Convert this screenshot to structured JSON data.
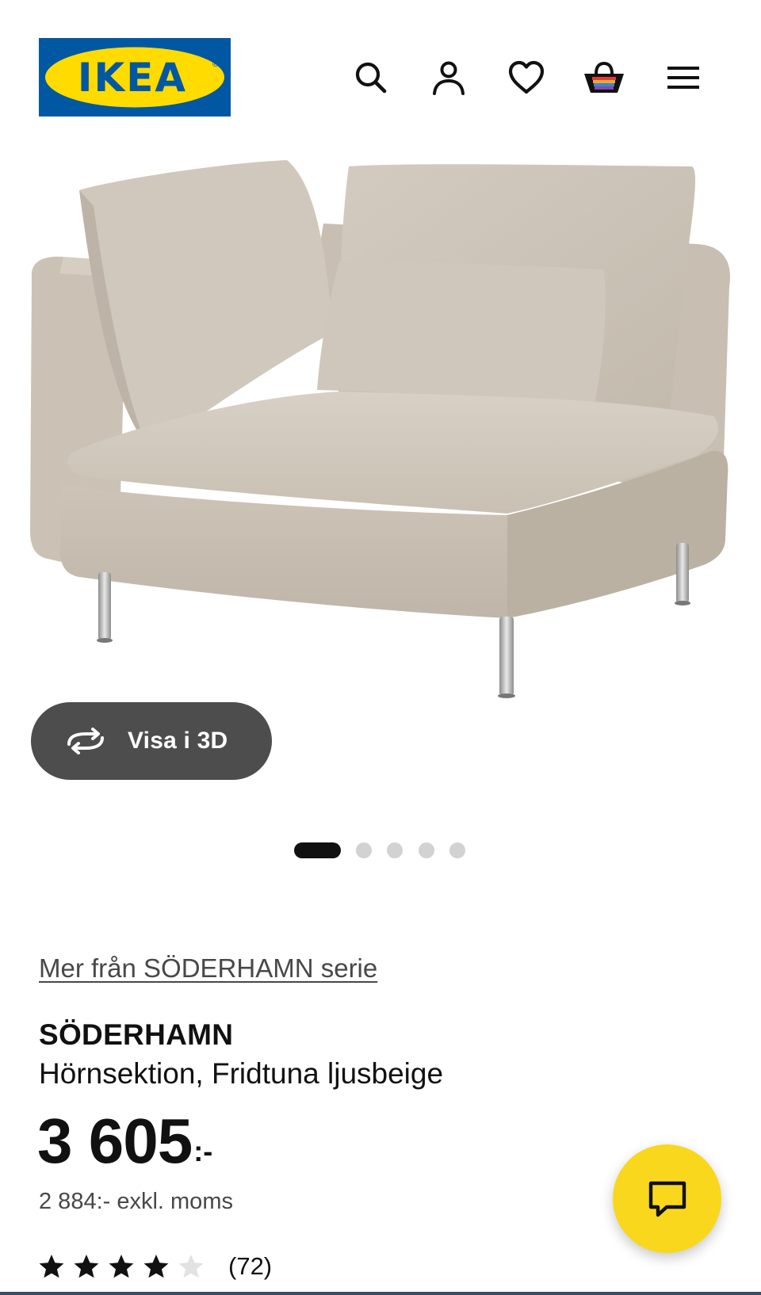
{
  "header": {
    "logo_text": "IKEA",
    "logo_mark": "®",
    "icons": [
      "search-icon",
      "account-icon",
      "heart-icon",
      "basket-icon",
      "menu-icon"
    ]
  },
  "gallery": {
    "view_3d_label": "Visa i 3D",
    "view_3d_icon": "rotate-3d-icon",
    "slide_count": 5,
    "active_slide": 1
  },
  "product": {
    "series_link": "Mer från SÖDERHAMN serie",
    "name": "SÖDERHAMN",
    "description": "Hörnsektion, Fridtuna ljusbeige",
    "price_integer": "3 605",
    "price_suffix": ":-",
    "price_excl_vat": "2 884:- exkl. moms",
    "rating_value": 4,
    "rating_max": 5,
    "rating_count": "(72)"
  },
  "chat": {
    "icon": "chat-bubble-icon"
  },
  "colors": {
    "ikea_blue": "#0058a3",
    "ikea_yellow": "#ffdb00",
    "chat_yellow": "#f9d71c",
    "button_dark": "#4d4d4d",
    "text_primary": "#111111",
    "text_secondary": "#484848",
    "dot_inactive": "#d2d2d2"
  }
}
